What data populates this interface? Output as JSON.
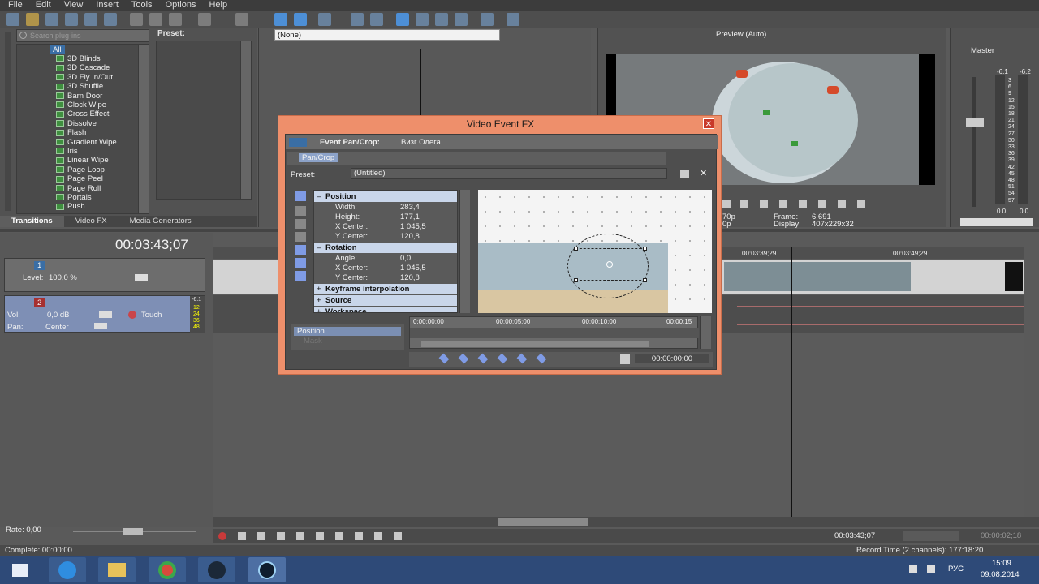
{
  "menu": [
    "File",
    "Edit",
    "View",
    "Insert",
    "Tools",
    "Options",
    "Help"
  ],
  "explorer": {
    "search_placeholder": "Search plug-ins",
    "preset_label": "Preset:",
    "root": "All",
    "items": [
      "3D Blinds",
      "3D Cascade",
      "3D Fly In/Out",
      "3D Shuffle",
      "Barn Door",
      "Clock Wipe",
      "Cross Effect",
      "Dissolve",
      "Flash",
      "Gradient Wipe",
      "Iris",
      "Linear Wipe",
      "Page Loop",
      "Page Peel",
      "Page Roll",
      "Portals",
      "Push"
    ],
    "tabs": [
      "Transitions",
      "Video FX",
      "Media Generators"
    ]
  },
  "trimmer": {
    "dropdown": "(None)"
  },
  "preview": {
    "label": "Preview (Auto)",
    "frame_label": "Frame:",
    "frame_value": "6 691",
    "display_label": "Display:",
    "display_value": "407x229x32",
    "res_partial": "70p",
    "res_partial2": "0p"
  },
  "master": {
    "label": "Master",
    "peak_left": "-6.1",
    "peak_right": "-6.2",
    "scale": [
      "3",
      "6",
      "9",
      "12",
      "15",
      "18",
      "21",
      "24",
      "27",
      "30",
      "33",
      "36",
      "39",
      "42",
      "45",
      "48",
      "51",
      "54",
      "57"
    ],
    "bottom_left": "0.0",
    "bottom_right": "0.0"
  },
  "timeline": {
    "timecode": "00:03:43;07",
    "ruler": [
      "00:03:39;29",
      "00:03:49;29"
    ],
    "track1": {
      "number": "1",
      "level_label": "Level:",
      "level_value": "100,0 %"
    },
    "track2": {
      "number": "2",
      "vol_label": "Vol:",
      "vol_value": "0,0 dB",
      "pan_label": "Pan:",
      "pan_value": "Center",
      "mode": "Touch",
      "meter": [
        "-6.1",
        "12",
        "24",
        "36",
        "48"
      ]
    }
  },
  "dialog": {
    "title": "Video Event FX",
    "event_label": "Event Pan/Crop:",
    "event_name": "Визг Олега",
    "chain_tab": "Pan/Crop",
    "preset_label": "Preset:",
    "preset_value": "(Untitled)",
    "position_header": "Position",
    "position_rows": [
      {
        "k": "Width:",
        "v": "283,4"
      },
      {
        "k": "Height:",
        "v": "177,1"
      },
      {
        "k": "X Center:",
        "v": "1 045,5"
      },
      {
        "k": "Y Center:",
        "v": "120,8"
      }
    ],
    "rotation_header": "Rotation",
    "rotation_rows": [
      {
        "k": "Angle:",
        "v": "0,0"
      },
      {
        "k": "X Center:",
        "v": "1 045,5"
      },
      {
        "k": "Y Center:",
        "v": "120,8"
      }
    ],
    "keyframe_header": "Keyframe interpolation",
    "source_header": "Source",
    "workspace_header": "Workspace",
    "kf_track": "Position",
    "kf_track2": "Mask",
    "kf_ruler": [
      "0:00:00:00",
      "00:00:05:00",
      "00:00:10:00",
      "00:00:15"
    ],
    "kf_time": "00:00:00;00"
  },
  "transport": {
    "rate_label": "Rate: 0,00",
    "cursor_time": "00:03:43;07",
    "selection_time": "00:00:02;18"
  },
  "status": {
    "left": "Complete: 00:00:00",
    "right": "Record Time (2 channels): 177:18:20"
  },
  "taskbar": {
    "lang": "РУС",
    "time": "15:09",
    "date": "09.08.2014"
  },
  "colors": {
    "dialog_frame": "#ee8f6b",
    "track2": "#7e8fb5",
    "selection": "#3a6ea5"
  }
}
